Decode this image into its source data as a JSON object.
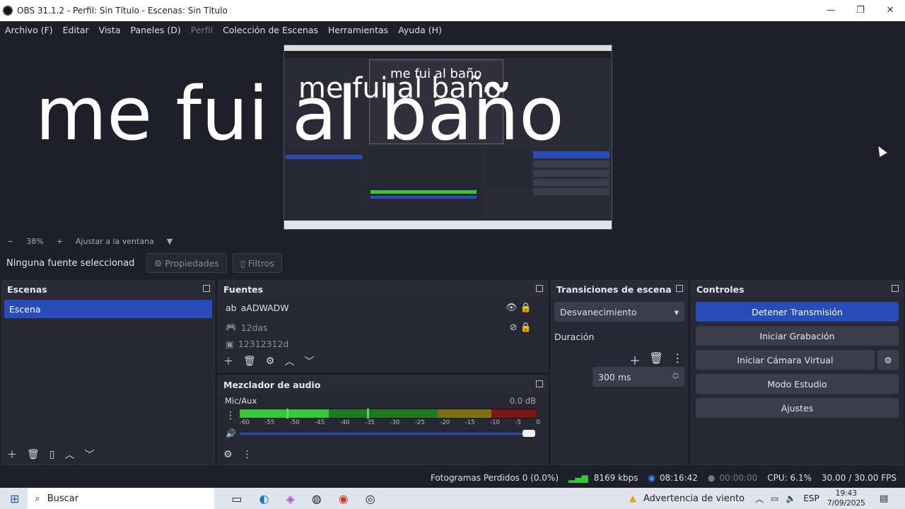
{
  "window": {
    "title": "OBS 31.1.2 - Perfil: Sin Título - Escenas: Sin Título"
  },
  "menu": [
    "Archivo (F)",
    "Editar",
    "Vista",
    "Paneles (D)",
    "Perfil",
    "Colección de Escenas",
    "Herramientas",
    "Ayuda (H)"
  ],
  "overlay": {
    "big_text": "me fui al baño",
    "mid_text": "me fui al baño",
    "small_text": "me fui al baño"
  },
  "zoom": {
    "minus": "−",
    "value": "38%",
    "plus": "+",
    "fit": "Ajustar a la ventana"
  },
  "source_toolbar": {
    "no_selection": "Ninguna fuente seleccionad",
    "properties": "Propiedades",
    "filters": "Filtros"
  },
  "scenes": {
    "title": "Escenas",
    "items": [
      "Escena"
    ]
  },
  "sources": {
    "title": "Fuentes",
    "items": [
      {
        "name": "aADWADW",
        "visible": true
      },
      {
        "name": "12das",
        "visible": false
      },
      {
        "name": "12312312d",
        "visible": false
      }
    ]
  },
  "mixer": {
    "title": "Mezclador de audio",
    "channel": "Mic/Aux",
    "db": "0.0 dB",
    "scale": [
      "-60",
      "-55",
      "-50",
      "-45",
      "-40",
      "-35",
      "-30",
      "-25",
      "-20",
      "-15",
      "-10",
      "-5",
      "0"
    ]
  },
  "transitions": {
    "title": "Transiciones de escena",
    "selected": "Desvanecimiento",
    "duration_label": "Duración",
    "duration_value": "300 ms"
  },
  "controls": {
    "title": "Controles",
    "stop_stream": "Detener Transmisión",
    "start_record": "Iniciar Grabación",
    "virtual_cam": "Iniciar Cámara Virtual",
    "studio": "Modo Estudio",
    "settings": "Ajustes"
  },
  "status": {
    "dropped": "Fotogramas Perdidos 0 (0.0%)",
    "bitrate": "8169 kbps",
    "stream_time": "08:16:42",
    "rec_time": "00:00:00",
    "cpu": "CPU: 6.1%",
    "fps": "30.00 / 30.00 FPS"
  },
  "taskbar": {
    "search": "Buscar",
    "weather": "Advertencia de viento",
    "lang": "ESP",
    "time": "19:43",
    "date": "7/09/2025"
  },
  "colors": {
    "accent": "#284cb8",
    "meter_green": "#37c73a",
    "meter_yellow": "#c8b21e",
    "meter_red": "#b52121"
  }
}
